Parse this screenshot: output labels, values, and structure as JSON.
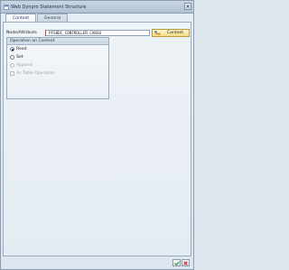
{
  "window": {
    "title": "Web Dynpro Statement Structure"
  },
  "tabs": [
    {
      "label": "Context",
      "active": true
    },
    {
      "label": "General",
      "active": false
    }
  ],
  "form": {
    "node_label": "Node/Attribute",
    "node_value": "PFSBDC_CONTROLLER.CARGO",
    "context_button": "Context"
  },
  "operation": {
    "title": "Operation on Context",
    "options": [
      {
        "label": "Read",
        "selected": true,
        "enabled": true
      },
      {
        "label": "Set",
        "selected": false,
        "enabled": true
      },
      {
        "label": "Append",
        "selected": false,
        "enabled": false
      }
    ],
    "as_table_operation": {
      "label": "As Table Operation",
      "checked": false,
      "enabled": false
    }
  },
  "footer": {
    "buttons": [
      "confirm-icon",
      "cancel-icon"
    ]
  },
  "colors": {
    "accent": "#f2dc86",
    "confirm": "#2e9b2e",
    "cancel": "#c62828"
  }
}
